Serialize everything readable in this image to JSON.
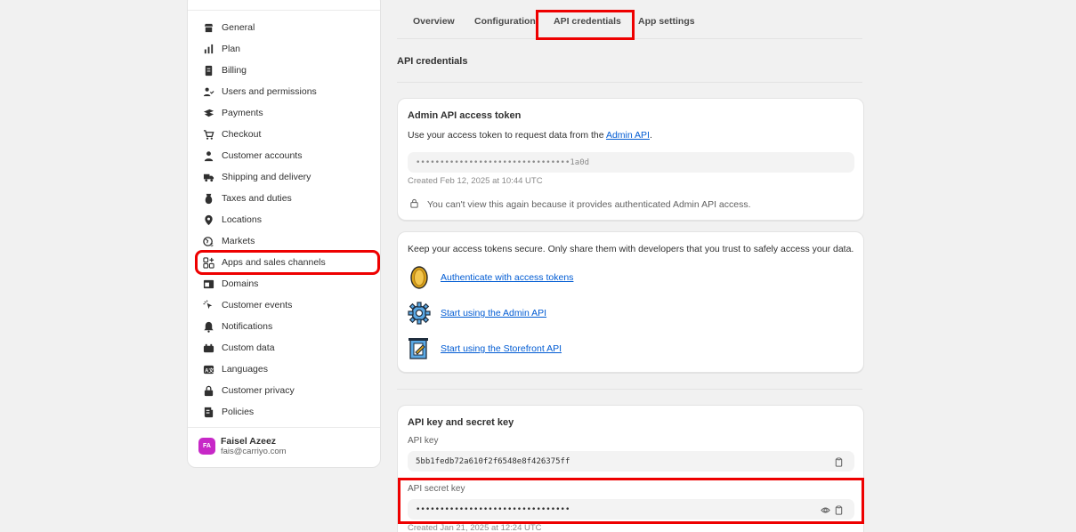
{
  "sidebar": {
    "items": [
      {
        "label": "General",
        "icon": "store-icon"
      },
      {
        "label": "Plan",
        "icon": "plan-icon"
      },
      {
        "label": "Billing",
        "icon": "billing-icon"
      },
      {
        "label": "Users and permissions",
        "icon": "users-icon"
      },
      {
        "label": "Payments",
        "icon": "payments-icon"
      },
      {
        "label": "Checkout",
        "icon": "cart-icon"
      },
      {
        "label": "Customer accounts",
        "icon": "person-icon"
      },
      {
        "label": "Shipping and delivery",
        "icon": "truck-icon"
      },
      {
        "label": "Taxes and duties",
        "icon": "tax-icon"
      },
      {
        "label": "Locations",
        "icon": "location-icon"
      },
      {
        "label": "Markets",
        "icon": "globe-icon"
      },
      {
        "label": "Apps and sales channels",
        "icon": "apps-icon"
      },
      {
        "label": "Domains",
        "icon": "domains-icon"
      },
      {
        "label": "Customer events",
        "icon": "cursor-icon"
      },
      {
        "label": "Notifications",
        "icon": "bell-icon"
      },
      {
        "label": "Custom data",
        "icon": "custom-data-icon"
      },
      {
        "label": "Languages",
        "icon": "language-icon"
      },
      {
        "label": "Customer privacy",
        "icon": "lock-icon"
      },
      {
        "label": "Policies",
        "icon": "policy-icon"
      }
    ],
    "active_index": 11,
    "user": {
      "initials": "FA",
      "name": "Faisel Azeez",
      "email": "fais@carriyo.com"
    }
  },
  "tabs": [
    {
      "label": "Overview"
    },
    {
      "label": "Configuration"
    },
    {
      "label": "API credentials"
    },
    {
      "label": "App settings"
    }
  ],
  "active_tab": 2,
  "section_title": "API credentials",
  "admin_token": {
    "title": "Admin API access token",
    "desc_prefix": "Use your access token to request data from the ",
    "desc_link": "Admin API",
    "desc_suffix": ".",
    "token_value": "••••••••••••••••••••••••••••••••1a0d",
    "created": "Created Feb 12, 2025 at 10:44 UTC",
    "warning": "You can't view this again because it provides authenticated Admin API access."
  },
  "security": {
    "text": "Keep your access tokens secure. Only share them with developers that you trust to safely access your data.",
    "links": [
      {
        "label": "Authenticate with access tokens",
        "icon": "coin-icon"
      },
      {
        "label": "Start using the Admin API",
        "icon": "gear-icon"
      },
      {
        "label": "Start using the Storefront API",
        "icon": "storefront-icon"
      }
    ]
  },
  "api_keys": {
    "title": "API key and secret key",
    "api_key_label": "API key",
    "api_key_value": "5bb1fedb72a610f2f6548e8f426375ff",
    "secret_label": "API secret key",
    "secret_value": "••••••••••••••••••••••••••••••••",
    "created": "Created Jan 21, 2025 at 12:24 UTC"
  },
  "colors": {
    "highlight": "#ee0000",
    "link": "#005bd3",
    "avatar": "#c728c7"
  }
}
